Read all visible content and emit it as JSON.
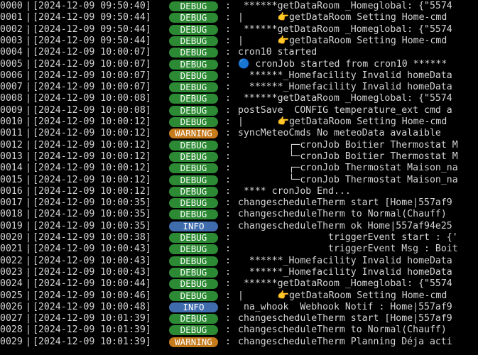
{
  "levels": {
    "DEBUG": {
      "color": "#2d8a34"
    },
    "WARNING": {
      "color": "#c57a1c"
    },
    "INFO": {
      "color": "#3f6cad"
    }
  },
  "rows": [
    {
      "num": "0000",
      "ts": "[2024-12-09 09:50:40]",
      "level": "DEBUG",
      "msg": " ******getDataRoom _Homeglobal: {\"5574"
    },
    {
      "num": "0001",
      "ts": "[2024-12-09 09:50:44]",
      "level": "DEBUG",
      "msg": "|      👉getDataRoom Setting Home-cmd"
    },
    {
      "num": "0002",
      "ts": "[2024-12-09 09:50:44]",
      "level": "DEBUG",
      "msg": " ******getDataRoom _Homeglobal: {\"5574"
    },
    {
      "num": "0003",
      "ts": "[2024-12-09 09:50:44]",
      "level": "DEBUG",
      "msg": "|      👉getDataRoom Setting Home-cmd"
    },
    {
      "num": "0004",
      "ts": "[2024-12-09 10:00:07]",
      "level": "DEBUG",
      "msg": "cron10 started"
    },
    {
      "num": "0005",
      "ts": "[2024-12-09 10:00:07]",
      "level": "DEBUG",
      "msg": "🔵 cronJob started from cron10 ******"
    },
    {
      "num": "0006",
      "ts": "[2024-12-09 10:00:07]",
      "level": "DEBUG",
      "msg": "  ******_Homefacility Invalid homeData"
    },
    {
      "num": "0007",
      "ts": "[2024-12-09 10:00:07]",
      "level": "DEBUG",
      "msg": "  ******_Homefacility Invalid homeData"
    },
    {
      "num": "0008",
      "ts": "[2024-12-09 10:00:08]",
      "level": "DEBUG",
      "msg": " ******getDataRoom _Homeglobal: {\"5574"
    },
    {
      "num": "0009",
      "ts": "[2024-12-09 10:00:08]",
      "level": "DEBUG",
      "msg": "postSave  CONFIG temperature_ext cmd a"
    },
    {
      "num": "0010",
      "ts": "[2024-12-09 10:00:12]",
      "level": "DEBUG",
      "msg": "|      👉getDataRoom Setting Home-cmd"
    },
    {
      "num": "0011",
      "ts": "[2024-12-09 10:00:12]",
      "level": "WARNING",
      "msg": "syncMeteoCmds No meteoData avalaible"
    },
    {
      "num": "0012",
      "ts": "[2024-12-09 10:00:12]",
      "level": "DEBUG",
      "msg": "         ┌─cronJob Boitier Thermostat M"
    },
    {
      "num": "0013",
      "ts": "[2024-12-09 10:00:12]",
      "level": "DEBUG",
      "msg": "         └─cronJob Boitier Thermostat M"
    },
    {
      "num": "0014",
      "ts": "[2024-12-09 10:00:12]",
      "level": "DEBUG",
      "msg": "         ┌─cronJob Thermostat Maison_na"
    },
    {
      "num": "0015",
      "ts": "[2024-12-09 10:00:12]",
      "level": "DEBUG",
      "msg": "         └─cronJob Thermostat Maison_na"
    },
    {
      "num": "0016",
      "ts": "[2024-12-09 10:00:12]",
      "level": "DEBUG",
      "msg": " **** cronJob End..."
    },
    {
      "num": "0017",
      "ts": "[2024-12-09 10:00:35]",
      "level": "DEBUG",
      "msg": "changescheduleTherm start [Home|557af9"
    },
    {
      "num": "0018",
      "ts": "[2024-12-09 10:00:35]",
      "level": "DEBUG",
      "msg": "changescheduleTherm to Normal(Chauff)"
    },
    {
      "num": "0019",
      "ts": "[2024-12-09 10:00:35]",
      "level": "INFO",
      "msg": "changescheduleTherm ok Home|557af94e25"
    },
    {
      "num": "0020",
      "ts": "[2024-12-09 10:00:38]",
      "level": "DEBUG",
      "msg": "                triggerEvent start : {'"
    },
    {
      "num": "0021",
      "ts": "[2024-12-09 10:00:43]",
      "level": "DEBUG",
      "msg": "                triggerEvent Msg : Boit"
    },
    {
      "num": "0022",
      "ts": "[2024-12-09 10:00:43]",
      "level": "DEBUG",
      "msg": "  ******_Homefacility Invalid homeData"
    },
    {
      "num": "0023",
      "ts": "[2024-12-09 10:00:43]",
      "level": "DEBUG",
      "msg": "  ******_Homefacility Invalid homeData"
    },
    {
      "num": "0024",
      "ts": "[2024-12-09 10:00:44]",
      "level": "DEBUG",
      "msg": " ******getDataRoom _Homeglobal: {\"5574"
    },
    {
      "num": "0025",
      "ts": "[2024-12-09 10:00:46]",
      "level": "DEBUG",
      "msg": "|      👉getDataRoom Setting Home-cmd"
    },
    {
      "num": "0026",
      "ts": "[2024-12-09 10:00:48]",
      "level": "INFO",
      "msg": " na_whook  Webhook Notif : Home|557af9"
    },
    {
      "num": "0027",
      "ts": "[2024-12-09 10:01:39]",
      "level": "DEBUG",
      "msg": "changescheduleTherm start [Home|557af9"
    },
    {
      "num": "0028",
      "ts": "[2024-12-09 10:01:39]",
      "level": "DEBUG",
      "msg": "changescheduleTherm to Normal(Chauff)"
    },
    {
      "num": "0029",
      "ts": "[2024-12-09 10:01:39]",
      "level": "WARNING",
      "msg": "changescheduleTherm Planning Déja acti"
    }
  ]
}
